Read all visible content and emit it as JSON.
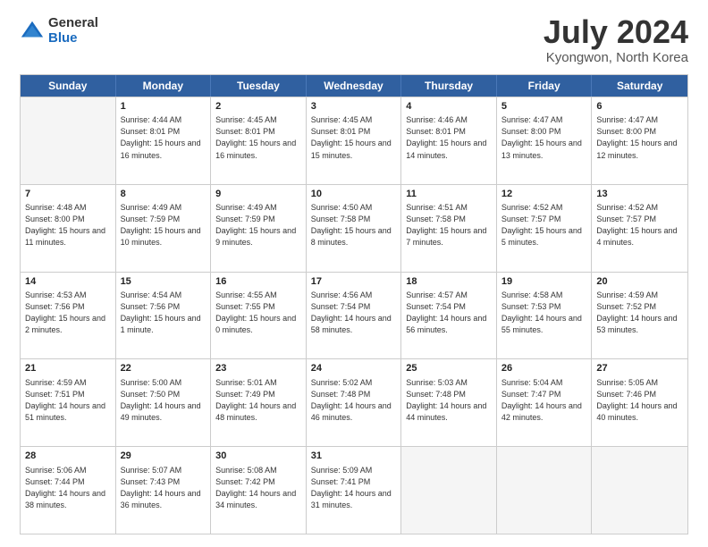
{
  "logo": {
    "general": "General",
    "blue": "Blue"
  },
  "title": {
    "month": "July 2024",
    "location": "Kyongwon, North Korea"
  },
  "header_days": [
    "Sunday",
    "Monday",
    "Tuesday",
    "Wednesday",
    "Thursday",
    "Friday",
    "Saturday"
  ],
  "rows": [
    [
      {
        "day": "",
        "sunrise": "",
        "sunset": "",
        "daylight": "",
        "empty": true
      },
      {
        "day": "1",
        "sunrise": "Sunrise: 4:44 AM",
        "sunset": "Sunset: 8:01 PM",
        "daylight": "Daylight: 15 hours and 16 minutes."
      },
      {
        "day": "2",
        "sunrise": "Sunrise: 4:45 AM",
        "sunset": "Sunset: 8:01 PM",
        "daylight": "Daylight: 15 hours and 16 minutes."
      },
      {
        "day": "3",
        "sunrise": "Sunrise: 4:45 AM",
        "sunset": "Sunset: 8:01 PM",
        "daylight": "Daylight: 15 hours and 15 minutes."
      },
      {
        "day": "4",
        "sunrise": "Sunrise: 4:46 AM",
        "sunset": "Sunset: 8:01 PM",
        "daylight": "Daylight: 15 hours and 14 minutes."
      },
      {
        "day": "5",
        "sunrise": "Sunrise: 4:47 AM",
        "sunset": "Sunset: 8:00 PM",
        "daylight": "Daylight: 15 hours and 13 minutes."
      },
      {
        "day": "6",
        "sunrise": "Sunrise: 4:47 AM",
        "sunset": "Sunset: 8:00 PM",
        "daylight": "Daylight: 15 hours and 12 minutes."
      }
    ],
    [
      {
        "day": "7",
        "sunrise": "Sunrise: 4:48 AM",
        "sunset": "Sunset: 8:00 PM",
        "daylight": "Daylight: 15 hours and 11 minutes."
      },
      {
        "day": "8",
        "sunrise": "Sunrise: 4:49 AM",
        "sunset": "Sunset: 7:59 PM",
        "daylight": "Daylight: 15 hours and 10 minutes."
      },
      {
        "day": "9",
        "sunrise": "Sunrise: 4:49 AM",
        "sunset": "Sunset: 7:59 PM",
        "daylight": "Daylight: 15 hours and 9 minutes."
      },
      {
        "day": "10",
        "sunrise": "Sunrise: 4:50 AM",
        "sunset": "Sunset: 7:58 PM",
        "daylight": "Daylight: 15 hours and 8 minutes."
      },
      {
        "day": "11",
        "sunrise": "Sunrise: 4:51 AM",
        "sunset": "Sunset: 7:58 PM",
        "daylight": "Daylight: 15 hours and 7 minutes."
      },
      {
        "day": "12",
        "sunrise": "Sunrise: 4:52 AM",
        "sunset": "Sunset: 7:57 PM",
        "daylight": "Daylight: 15 hours and 5 minutes."
      },
      {
        "day": "13",
        "sunrise": "Sunrise: 4:52 AM",
        "sunset": "Sunset: 7:57 PM",
        "daylight": "Daylight: 15 hours and 4 minutes."
      }
    ],
    [
      {
        "day": "14",
        "sunrise": "Sunrise: 4:53 AM",
        "sunset": "Sunset: 7:56 PM",
        "daylight": "Daylight: 15 hours and 2 minutes."
      },
      {
        "day": "15",
        "sunrise": "Sunrise: 4:54 AM",
        "sunset": "Sunset: 7:56 PM",
        "daylight": "Daylight: 15 hours and 1 minute."
      },
      {
        "day": "16",
        "sunrise": "Sunrise: 4:55 AM",
        "sunset": "Sunset: 7:55 PM",
        "daylight": "Daylight: 15 hours and 0 minutes."
      },
      {
        "day": "17",
        "sunrise": "Sunrise: 4:56 AM",
        "sunset": "Sunset: 7:54 PM",
        "daylight": "Daylight: 14 hours and 58 minutes."
      },
      {
        "day": "18",
        "sunrise": "Sunrise: 4:57 AM",
        "sunset": "Sunset: 7:54 PM",
        "daylight": "Daylight: 14 hours and 56 minutes."
      },
      {
        "day": "19",
        "sunrise": "Sunrise: 4:58 AM",
        "sunset": "Sunset: 7:53 PM",
        "daylight": "Daylight: 14 hours and 55 minutes."
      },
      {
        "day": "20",
        "sunrise": "Sunrise: 4:59 AM",
        "sunset": "Sunset: 7:52 PM",
        "daylight": "Daylight: 14 hours and 53 minutes."
      }
    ],
    [
      {
        "day": "21",
        "sunrise": "Sunrise: 4:59 AM",
        "sunset": "Sunset: 7:51 PM",
        "daylight": "Daylight: 14 hours and 51 minutes."
      },
      {
        "day": "22",
        "sunrise": "Sunrise: 5:00 AM",
        "sunset": "Sunset: 7:50 PM",
        "daylight": "Daylight: 14 hours and 49 minutes."
      },
      {
        "day": "23",
        "sunrise": "Sunrise: 5:01 AM",
        "sunset": "Sunset: 7:49 PM",
        "daylight": "Daylight: 14 hours and 48 minutes."
      },
      {
        "day": "24",
        "sunrise": "Sunrise: 5:02 AM",
        "sunset": "Sunset: 7:48 PM",
        "daylight": "Daylight: 14 hours and 46 minutes."
      },
      {
        "day": "25",
        "sunrise": "Sunrise: 5:03 AM",
        "sunset": "Sunset: 7:48 PM",
        "daylight": "Daylight: 14 hours and 44 minutes."
      },
      {
        "day": "26",
        "sunrise": "Sunrise: 5:04 AM",
        "sunset": "Sunset: 7:47 PM",
        "daylight": "Daylight: 14 hours and 42 minutes."
      },
      {
        "day": "27",
        "sunrise": "Sunrise: 5:05 AM",
        "sunset": "Sunset: 7:46 PM",
        "daylight": "Daylight: 14 hours and 40 minutes."
      }
    ],
    [
      {
        "day": "28",
        "sunrise": "Sunrise: 5:06 AM",
        "sunset": "Sunset: 7:44 PM",
        "daylight": "Daylight: 14 hours and 38 minutes."
      },
      {
        "day": "29",
        "sunrise": "Sunrise: 5:07 AM",
        "sunset": "Sunset: 7:43 PM",
        "daylight": "Daylight: 14 hours and 36 minutes."
      },
      {
        "day": "30",
        "sunrise": "Sunrise: 5:08 AM",
        "sunset": "Sunset: 7:42 PM",
        "daylight": "Daylight: 14 hours and 34 minutes."
      },
      {
        "day": "31",
        "sunrise": "Sunrise: 5:09 AM",
        "sunset": "Sunset: 7:41 PM",
        "daylight": "Daylight: 14 hours and 31 minutes."
      },
      {
        "day": "",
        "sunrise": "",
        "sunset": "",
        "daylight": "",
        "empty": true
      },
      {
        "day": "",
        "sunrise": "",
        "sunset": "",
        "daylight": "",
        "empty": true
      },
      {
        "day": "",
        "sunrise": "",
        "sunset": "",
        "daylight": "",
        "empty": true
      }
    ]
  ]
}
